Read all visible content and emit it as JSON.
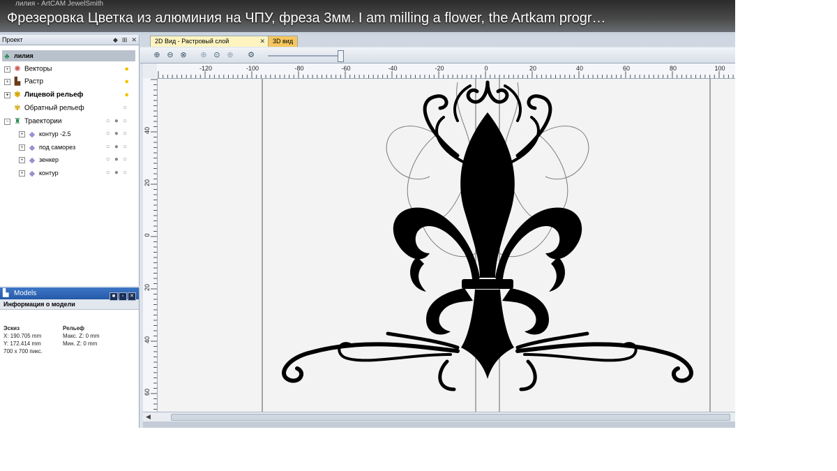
{
  "app_title": "лилия - ArtCAM JewelSmith",
  "video_title": "Фрезеровка Цветка из алюминия на ЧПУ, фреза 3мм. I am milling a flower, the Artkam progr…",
  "project_panel": {
    "title": "Проект",
    "root": "лилия",
    "items": [
      {
        "label": "Векторы",
        "bold": false,
        "icon": "vectors-icon"
      },
      {
        "label": "Растр",
        "bold": false,
        "icon": "raster-icon"
      },
      {
        "label": "Лицевой рельеф",
        "bold": true,
        "icon": "relief-icon"
      },
      {
        "label": "Обратный рельеф",
        "bold": false,
        "icon": "back-relief-icon"
      },
      {
        "label": "Траектории",
        "bold": false,
        "icon": "toolpaths-icon"
      }
    ],
    "toolpaths": [
      {
        "label": "контур -2.5"
      },
      {
        "label": "под саморез"
      },
      {
        "label": "зенкер"
      },
      {
        "label": "контур"
      }
    ]
  },
  "models_panel": {
    "title": "Models",
    "info_title": "Информация о модели",
    "sketch_heading": "Эскиз",
    "relief_heading": "Рельеф",
    "x_value": "X: 190.705 mm",
    "y_value": "Y: 172.414 mm",
    "size_value": "700 x 700 пикс.",
    "max_z": "Макс. Z: 0 mm",
    "min_z": "Мин. Z: 0 mm"
  },
  "tabs": {
    "tab_2d": "2D Вид - Растровый слой",
    "tab_3d": "3D вид"
  },
  "ruler": {
    "h_labels": [
      "-120",
      "-100",
      "-80",
      "-60",
      "-40",
      "-20",
      "0",
      "20",
      "40",
      "60",
      "80",
      "100"
    ],
    "v_labels": [
      "40",
      "20",
      "0",
      "20",
      "40",
      "60"
    ]
  },
  "zoom_level": 0.96,
  "colors": {
    "title_text": "#ffffff",
    "models_header": "#2f66b8",
    "tab_3d": "#f6c65d",
    "tab_2d": "#fff4c0"
  }
}
